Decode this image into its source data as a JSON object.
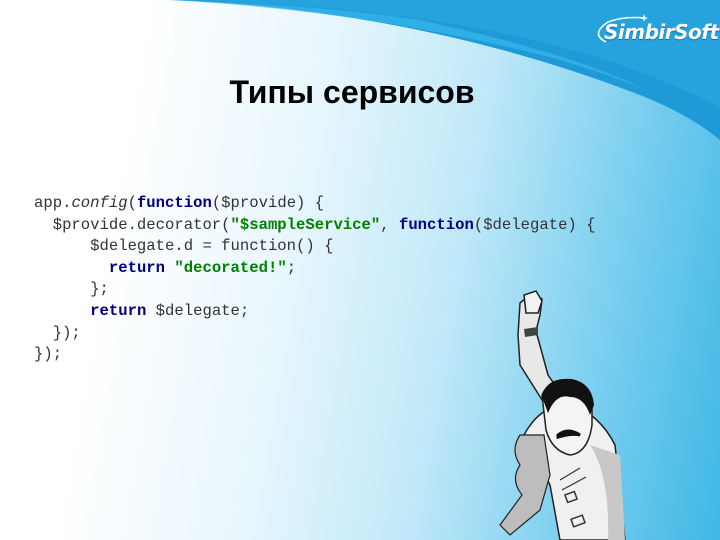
{
  "brand": {
    "logo_text": "SimbirSoft",
    "accent_color": "#1e9bd7"
  },
  "slide": {
    "title": "Типы сервисов",
    "code_lines": [
      [
        {
          "t": "app.",
          "c": "plain"
        },
        {
          "t": "config",
          "c": "it"
        },
        {
          "t": "(",
          "c": "plain"
        },
        {
          "t": "function",
          "c": "kw"
        },
        {
          "t": "($provide) {",
          "c": "plain"
        }
      ],
      [
        {
          "t": "  $provide.decorator(",
          "c": "plain"
        },
        {
          "t": "\"$sampleService\"",
          "c": "str"
        },
        {
          "t": ", ",
          "c": "plain"
        },
        {
          "t": "function",
          "c": "kw"
        },
        {
          "t": "($delegate) {",
          "c": "plain"
        }
      ],
      [
        {
          "t": "      $delegate.d = function() {",
          "c": "plain"
        }
      ],
      [
        {
          "t": "        ",
          "c": "plain"
        },
        {
          "t": "return",
          "c": "kw"
        },
        {
          "t": " ",
          "c": "plain"
        },
        {
          "t": "\"decorated!\"",
          "c": "str"
        },
        {
          "t": ";",
          "c": "plain"
        }
      ],
      [
        {
          "t": "      };",
          "c": "plain"
        }
      ],
      [
        {
          "t": "      ",
          "c": "plain"
        },
        {
          "t": "return",
          "c": "kw"
        },
        {
          "t": " $delegate;",
          "c": "plain"
        }
      ],
      [
        {
          "t": "  });",
          "c": "plain"
        }
      ],
      [
        {
          "t": "});",
          "c": "plain"
        }
      ]
    ],
    "illustration": "freddie-mercury-victory-pose"
  }
}
